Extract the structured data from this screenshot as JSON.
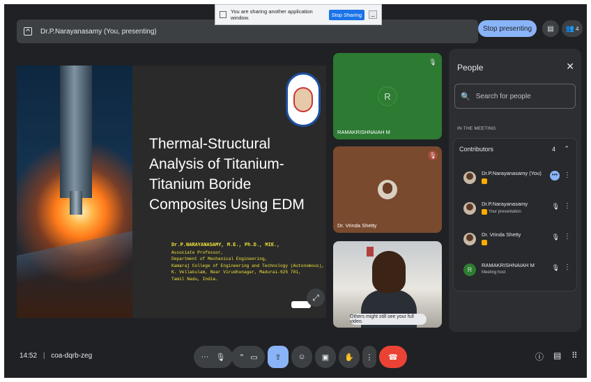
{
  "topbar": {
    "presenting_text": "Dr.P.Narayanasamy (You, presenting)",
    "stop_presenting_label": "Stop presenting",
    "participant_count": "4"
  },
  "share_popup": {
    "message": "You are sharing another application window.",
    "stop_sharing_label": "Stop Sharing",
    "minimize_label": "_"
  },
  "slide": {
    "title": "Thermal-Structural Analysis of Titanium-Titanium Boride Composites Using EDM",
    "author_lines": [
      "Dr.P.NARAYANASAMY, M.E., Ph.D., MIE.,",
      "Associate Professor,",
      "Department of Mechanical Engineering,",
      "Kamaraj College of Engineering and Technology (Autonomous),",
      "K. Vellakulam, Near Virudhunagar, Madurai-625 701,",
      "Tamil Nadu, India."
    ]
  },
  "tiles": [
    {
      "name": "RAMAKRISHNAIAH M",
      "avatar_letter": "R"
    },
    {
      "name": "Dr. Vrinda Shetty"
    },
    {
      "toast": "Others might still see your full video."
    }
  ],
  "people": {
    "title": "People",
    "search_placeholder": "Search for people",
    "section_label": "IN THE MEETING",
    "contributors_label": "Contributors",
    "contributors_count": "4",
    "rows": [
      {
        "name": "Dr.P.Narayanasamy (You)",
        "sub": ""
      },
      {
        "name": "Dr.P.Narayanasamy",
        "sub": "Your presentation"
      },
      {
        "name": "Dr. Vrinda Shetty",
        "sub": ""
      },
      {
        "name": "RAMAKRISHNAIAH M",
        "sub": "Meeting host",
        "avatar_letter": "R"
      }
    ]
  },
  "bottom": {
    "time": "14:52",
    "meeting_code": "coa-dqrb-zeg"
  }
}
